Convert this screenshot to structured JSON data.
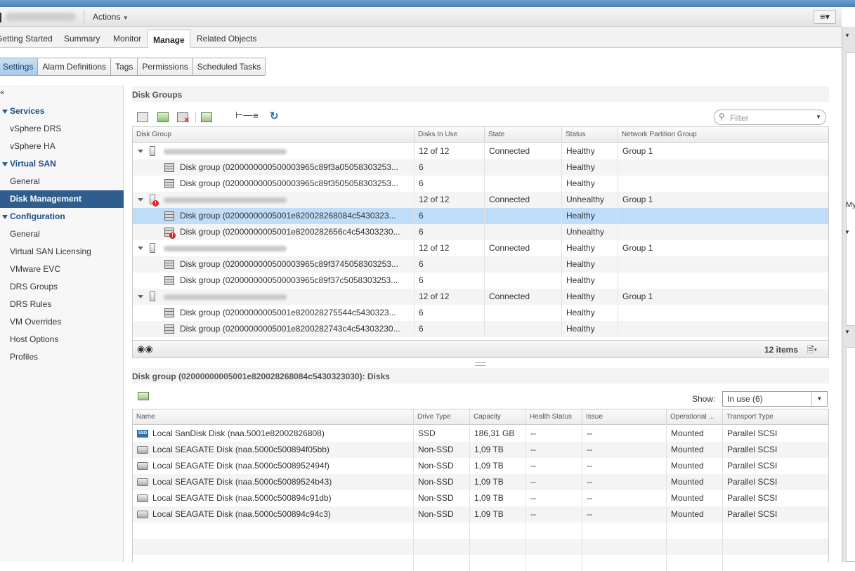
{
  "header": {
    "actions_label": "Actions",
    "menu_icon": "list-menu-icon"
  },
  "tabs": [
    {
      "label": "Getting Started",
      "active": false
    },
    {
      "label": "Summary",
      "active": false
    },
    {
      "label": "Monitor",
      "active": false
    },
    {
      "label": "Manage",
      "active": true
    },
    {
      "label": "Related Objects",
      "active": false
    }
  ],
  "subtabs": [
    {
      "label": "Settings",
      "active": true
    },
    {
      "label": "Alarm Definitions",
      "active": false
    },
    {
      "label": "Tags",
      "active": false
    },
    {
      "label": "Permissions",
      "active": false
    },
    {
      "label": "Scheduled Tasks",
      "active": false
    }
  ],
  "sidebar": {
    "collapse_icon": "«",
    "items": [
      {
        "label": "Services",
        "kind": "cat"
      },
      {
        "label": "vSphere DRS",
        "kind": "item"
      },
      {
        "label": "vSphere HA",
        "kind": "item"
      },
      {
        "label": "Virtual SAN",
        "kind": "cat"
      },
      {
        "label": "General",
        "kind": "item"
      },
      {
        "label": "Disk Management",
        "kind": "sel"
      },
      {
        "label": "Configuration",
        "kind": "cat"
      },
      {
        "label": "General",
        "kind": "item"
      },
      {
        "label": "Virtual SAN Licensing",
        "kind": "item"
      },
      {
        "label": "VMware EVC",
        "kind": "item"
      },
      {
        "label": "DRS Groups",
        "kind": "item"
      },
      {
        "label": "DRS Rules",
        "kind": "item"
      },
      {
        "label": "VM Overrides",
        "kind": "item"
      },
      {
        "label": "Host Options",
        "kind": "item"
      },
      {
        "label": "Profiles",
        "kind": "item"
      }
    ]
  },
  "disk_groups": {
    "title": "Disk Groups",
    "filter_placeholder": "Filter",
    "columns": [
      "Disk Group",
      "Disks In Use",
      "State",
      "Status",
      "Network Partition Group"
    ],
    "rows": [
      {
        "type": "host",
        "name": "",
        "disks": "12 of 12",
        "state": "Connected",
        "status": "Healthy",
        "group": "Group 1",
        "error": false
      },
      {
        "type": "dg",
        "name": "Disk group (0200000000500003965c89f3a05058303253...",
        "disks": "6",
        "state": "",
        "status": "Healthy",
        "group": "",
        "error": false
      },
      {
        "type": "dg",
        "name": "Disk group (0200000000500003965c89f3505058303253...",
        "disks": "6",
        "state": "",
        "status": "Healthy",
        "group": "",
        "error": false
      },
      {
        "type": "host",
        "name": "",
        "disks": "12 of 12",
        "state": "Connected",
        "status": "Unhealthy",
        "group": "Group 1",
        "error": true
      },
      {
        "type": "dg",
        "name": "Disk group (02000000005001e820028268084c5430323...",
        "disks": "6",
        "state": "",
        "status": "Healthy",
        "group": "",
        "error": false,
        "selected": true
      },
      {
        "type": "dg",
        "name": "Disk group (02000000005001e8200282656c4c54303230...",
        "disks": "6",
        "state": "",
        "status": "Unhealthy",
        "group": "",
        "error": true
      },
      {
        "type": "host",
        "name": "",
        "disks": "12 of 12",
        "state": "Connected",
        "status": "Healthy",
        "group": "Group 1",
        "error": false
      },
      {
        "type": "dg",
        "name": "Disk group (0200000000500003965c89f3745058303253...",
        "disks": "6",
        "state": "",
        "status": "Healthy",
        "group": "",
        "error": false
      },
      {
        "type": "dg",
        "name": "Disk group (0200000000500003965c89f37c5058303253...",
        "disks": "6",
        "state": "",
        "status": "Healthy",
        "group": "",
        "error": false
      },
      {
        "type": "host",
        "name": "",
        "disks": "12 of 12",
        "state": "Connected",
        "status": "Healthy",
        "group": "Group 1",
        "error": false
      },
      {
        "type": "dg",
        "name": "Disk group (02000000005001e820028275544c5430323...",
        "disks": "6",
        "state": "",
        "status": "Healthy",
        "group": "",
        "error": false
      },
      {
        "type": "dg",
        "name": "Disk group (02000000005001e8200282743c4c54303230...",
        "disks": "6",
        "state": "",
        "status": "Healthy",
        "group": "",
        "error": false
      }
    ],
    "items_count": "12 items"
  },
  "disks": {
    "title": "Disk group (02000000005001e820028268084c5430323030): Disks",
    "show_label": "Show:",
    "show_value": "In use (6)",
    "columns": [
      "Name",
      "Drive Type",
      "Capacity",
      "Health Status",
      "Issue",
      "Operational ...",
      "Transport Type"
    ],
    "rows": [
      {
        "name": "Local SanDisk Disk (naa.5001e82002826808)",
        "type": "SSD",
        "capacity": "186,31 GB",
        "health": "--",
        "issue": "--",
        "op": "Mounted",
        "transport": "Parallel SCSI",
        "ssd": true
      },
      {
        "name": "Local SEAGATE Disk (naa.5000c500894f05bb)",
        "type": "Non-SSD",
        "capacity": "1,09 TB",
        "health": "--",
        "issue": "--",
        "op": "Mounted",
        "transport": "Parallel SCSI",
        "ssd": false
      },
      {
        "name": "Local SEAGATE Disk (naa.5000c5008952494f)",
        "type": "Non-SSD",
        "capacity": "1,09 TB",
        "health": "--",
        "issue": "--",
        "op": "Mounted",
        "transport": "Parallel SCSI",
        "ssd": false
      },
      {
        "name": "Local SEAGATE Disk (naa.5000c50089524b43)",
        "type": "Non-SSD",
        "capacity": "1,09 TB",
        "health": "--",
        "issue": "--",
        "op": "Mounted",
        "transport": "Parallel SCSI",
        "ssd": false
      },
      {
        "name": "Local SEAGATE Disk (naa.5000c500894c91db)",
        "type": "Non-SSD",
        "capacity": "1,09 TB",
        "health": "--",
        "issue": "--",
        "op": "Mounted",
        "transport": "Parallel SCSI",
        "ssd": false
      },
      {
        "name": "Local SEAGATE Disk (naa.5000c500894c94c3)",
        "type": "Non-SSD",
        "capacity": "1,09 TB",
        "health": "--",
        "issue": "--",
        "op": "Mounted",
        "transport": "Parallel SCSI",
        "ssd": false
      }
    ]
  },
  "right_panel": {
    "label": "My"
  },
  "colors": {
    "accent": "#2f5e8e",
    "selected_row": "#bfdcf8",
    "category": "#1d4e86",
    "error": "#d22222"
  }
}
